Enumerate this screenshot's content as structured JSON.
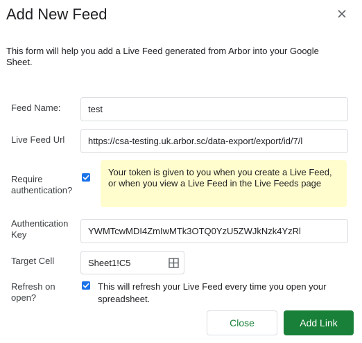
{
  "dialog": {
    "title": "Add New Feed",
    "close_icon": "close-icon",
    "intro": "This form will help you add a Live Feed generated from Arbor into your Google Sheet."
  },
  "form": {
    "feed_name": {
      "label": "Feed Name:",
      "value": "test"
    },
    "live_feed_url": {
      "label": "Live Feed Url",
      "value": "https://csa-testing.uk.arbor.sc/data-export/export/id/7/l"
    },
    "require_auth": {
      "label": "Require authentication?",
      "checked": true,
      "note": "Your token is given to you when you create a Live Feed, or when you view a Live Feed in the Live Feeds page"
    },
    "auth_key": {
      "label": "Authentication Key",
      "value": "YWMTcwMDI4ZmIwMTk3OTQ0YzU5ZWJkNzk4YzRl"
    },
    "target_cell": {
      "label": "Target Cell",
      "value": "Sheet1!C5",
      "icon": "grid-select-icon"
    },
    "refresh_on_open": {
      "label": "Refresh on open?",
      "checked": true,
      "text": "This will refresh your Live Feed every time you open your spreadsheet."
    }
  },
  "buttons": {
    "close": "Close",
    "add_link": "Add Link"
  },
  "colors": {
    "accent_blue": "#1a73e8",
    "primary_green": "#188038",
    "note_background": "#fffccd",
    "border": "#dadce0"
  }
}
